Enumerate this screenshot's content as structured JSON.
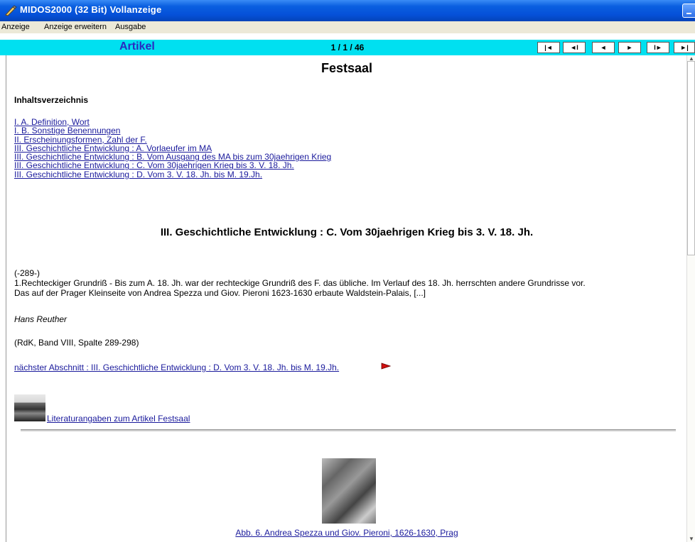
{
  "window": {
    "title": "MIDOS2000 (32 Bit)  Vollanzeige",
    "icon": "pen-icon"
  },
  "menu": [
    "Anzeige",
    "Anzeige erweitern",
    "Ausgabe"
  ],
  "navbar": {
    "section": "Artikel",
    "position": "1 / 1 / 46",
    "buttons": [
      "|◄",
      "◄I",
      "◄",
      "►",
      "I►",
      "►|"
    ]
  },
  "article": {
    "title": "Festsaal",
    "toc_heading": "Inhaltsverzeichnis",
    "toc": [
      "I. A. Definition, Wort",
      "I. B. Sonstige Benennungen",
      "II. Erscheinungsformen, Zahl der F.",
      "III. Geschichtliche Entwicklung : A. Vorlaeufer im MA",
      "III. Geschichtliche Entwicklung : B. Vom Ausgang des MA bis zum 30jaehrigen Krieg",
      "III. Geschichtliche Entwicklung : C. Vom 30jaehrigen Krieg bis 3. V. 18. Jh.",
      "III. Geschichtliche Entwicklung : D. Vom 3. V. 18. Jh. bis M. 19.Jh."
    ],
    "section_heading": "III. Geschichtliche Entwicklung : C. Vom 30jaehrigen Krieg bis 3. V. 18. Jh.",
    "page_ref": "(-289-)",
    "paragraph_line1": "1.Rechteckiger Grundriß - Bis zum A. 18. Jh. war der rechteckige Grundriß des F. das übliche. Im Verlauf des 18. Jh. herrschten andere Grundrisse vor.",
    "paragraph_line2": "Das auf der Prager Kleinseite von Andrea Spezza und Giov. Pieroni 1623-1630 erbaute Waldstein-Palais, [...]",
    "author": "Hans Reuther",
    "source": "(RdK, Band VIII, Spalte 289-298)",
    "next_link": "nächster Abschnitt : III. Geschichtliche Entwicklung : D. Vom 3. V. 18. Jh. bis M. 19.Jh.",
    "literature_link": "Literaturangaben zum Artikel Festsaal",
    "figure_caption": "Abb. 6. Andrea Spezza und Giov. Pieroni, 1626-1630, Prag"
  }
}
